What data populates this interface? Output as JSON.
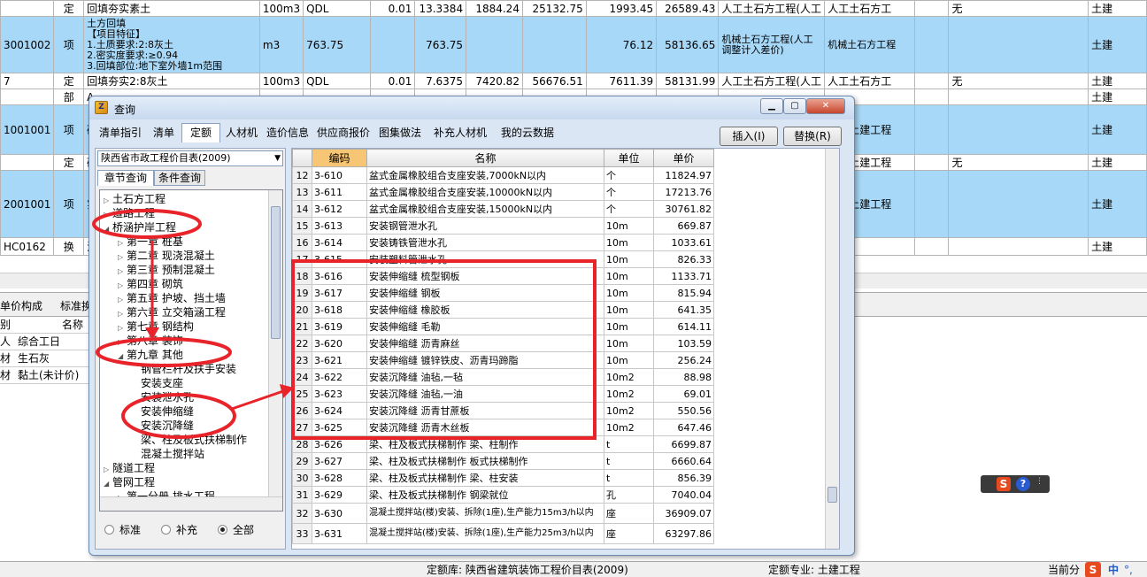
{
  "bg_rows": [
    {
      "code": "",
      "type": "定",
      "name": "回填夯实素土",
      "unit": "100m3",
      "qd": "QDL",
      "a": "0.01",
      "b": "13.3384",
      "c": "1884.24",
      "d": "25132.75",
      "e": "1993.45",
      "f": "26589.43",
      "g": "人工土石方工程(人工",
      "h": "人工土石方工",
      "i": "",
      "j": "无",
      "k": "土建"
    },
    {
      "code": "3001002",
      "type": "项",
      "name_lines": [
        "土方回填",
        "【项目特征】",
        "1.土质要求:2:8灰土",
        "2.密实度要求:≥0.94",
        "3.回填部位:地下室外墙1m范围"
      ],
      "unit": "m3",
      "qd": "763.75",
      "a": "",
      "b": "763.75",
      "c": "",
      "d": "",
      "e": "76.12",
      "f": "58136.65",
      "g": "机械土石方工程(人工调整计入差价)",
      "h": "机械土石方工程",
      "i": "",
      "j": "",
      "k": "土建"
    },
    {
      "code": "7",
      "type": "定",
      "name": "回填夯实2:8灰土",
      "unit": "100m3",
      "qd": "QDL",
      "a": "0.01",
      "b": "7.6375",
      "c": "7420.82",
      "d": "56676.51",
      "e": "7611.39",
      "f": "58131.99",
      "g": "人工土石方工程(人工",
      "h": "人工土石方工",
      "i": "",
      "j": "无",
      "k": "土建"
    },
    {
      "code": "",
      "type": "部",
      "name": "A.",
      "unit": "",
      "qd": "",
      "a": "",
      "b": "",
      "c": "",
      "d": "",
      "e": "",
      "f": "",
      "g": "",
      "h": "",
      "i": "",
      "j": "",
      "k": "土建"
    },
    {
      "code": "1001001",
      "type": "项",
      "name": "砖",
      "unit": "",
      "qd": "",
      "a": "",
      "b": "",
      "c": "",
      "d": "",
      "e": "",
      "f": "",
      "g": "",
      "h": "一般土建工程",
      "i": "",
      "j": "",
      "k": "土建"
    },
    {
      "code": "",
      "type": "定",
      "name": "砖",
      "unit": "",
      "qd": "",
      "a": "",
      "b": "",
      "c": "",
      "d": "",
      "e": "",
      "f": "",
      "g": "",
      "h": "一般土建工程",
      "i": "",
      "j": "无",
      "k": "土建"
    },
    {
      "code": "2001001",
      "type": "项",
      "name": "实",
      "unit": "",
      "qd": "",
      "a": "",
      "b": "",
      "c": "",
      "d": "",
      "e": "",
      "f": "",
      "g": "",
      "h": "一般土建工程",
      "i": "",
      "j": "",
      "k": "土建"
    },
    {
      "code": "HC0162",
      "type": "换",
      "name": "混",
      "unit": "",
      "qd": "",
      "a": "",
      "b": "",
      "c": "",
      "d": "",
      "e": "",
      "f": "",
      "g": "",
      "h": "",
      "i": "",
      "j": "",
      "k": "土建"
    }
  ],
  "lower": {
    "tabs": [
      "单价构成",
      "标准换"
    ],
    "col_type": "别",
    "col_name": "名称",
    "rows": [
      {
        "t": "人",
        "n": "综合工日"
      },
      {
        "t": "材",
        "n": "生石灰"
      },
      {
        "t": "材",
        "n": "黏土(未计价)"
      }
    ]
  },
  "status": {
    "lib": "定额库: 陕西省建筑装饰工程价目表(2009)",
    "major": "定额专业: 土建工程",
    "cur": "当前分"
  },
  "ime": {
    "zh": "中",
    "punct": "°,"
  },
  "dialog": {
    "title": "查询",
    "tabs": [
      "清单指引",
      "清单",
      "定额",
      "人材机",
      "造价信息",
      "供应商报价",
      "图集做法",
      "补充人材机",
      "我的云数据"
    ],
    "active_tab": "定额",
    "insert": "插入(I)",
    "replace": "替换(R)",
    "combo": "陕西省市政工程价目表(2009)",
    "subtabs": [
      "章节查询",
      "条件查询"
    ],
    "tree": [
      {
        "lv": 0,
        "tg": "▷",
        "t": "土石方工程"
      },
      {
        "lv": 0,
        "tg": "▷",
        "t": "道路工程"
      },
      {
        "lv": 0,
        "tg": "◢",
        "t": "桥涵护岸工程"
      },
      {
        "lv": 1,
        "tg": "▷",
        "t": "第一章 桩基"
      },
      {
        "lv": 1,
        "tg": "▷",
        "t": "第二章 现浇混凝土"
      },
      {
        "lv": 1,
        "tg": "▷",
        "t": "第三章 预制混凝土"
      },
      {
        "lv": 1,
        "tg": "▷",
        "t": "第四章 砌筑"
      },
      {
        "lv": 1,
        "tg": "▷",
        "t": "第五章 护坡、挡土墙"
      },
      {
        "lv": 1,
        "tg": "▷",
        "t": "第六章 立交箱涵工程"
      },
      {
        "lv": 1,
        "tg": "▷",
        "t": "第七章 钢结构"
      },
      {
        "lv": 1,
        "tg": "▷",
        "t": "第八章 装饰"
      },
      {
        "lv": 1,
        "tg": "◢",
        "t": "第九章 其他"
      },
      {
        "lv": 2,
        "tg": "",
        "t": "钢管栏杆及扶手安装"
      },
      {
        "lv": 2,
        "tg": "",
        "t": "安装支座"
      },
      {
        "lv": 2,
        "tg": "",
        "t": "安装泄水孔"
      },
      {
        "lv": 2,
        "tg": "",
        "t": "安装伸缩缝"
      },
      {
        "lv": 2,
        "tg": "",
        "t": "安装沉降缝"
      },
      {
        "lv": 2,
        "tg": "",
        "t": "梁、柱及板式扶梯制作"
      },
      {
        "lv": 2,
        "tg": "",
        "t": "混凝土搅拌站"
      },
      {
        "lv": 0,
        "tg": "▷",
        "t": "隧道工程"
      },
      {
        "lv": 0,
        "tg": "◢",
        "t": "管网工程"
      },
      {
        "lv": 1,
        "tg": "▷",
        "t": "第一分册 排水工程"
      }
    ],
    "radios": [
      "标准",
      "补充",
      "全部"
    ],
    "radio_selected": "全部",
    "headers": {
      "code": "编码",
      "name": "名称",
      "unit": "单位",
      "price": "单价"
    },
    "rows": [
      {
        "n": "12",
        "code": "3-610",
        "name": "盆式金属橡胶组合支座安装,7000kN以内",
        "unit": "个",
        "price": "11824.97"
      },
      {
        "n": "13",
        "code": "3-611",
        "name": "盆式金属橡胶组合支座安装,10000kN以内",
        "unit": "个",
        "price": "17213.76"
      },
      {
        "n": "14",
        "code": "3-612",
        "name": "盆式金属橡胶组合支座安装,15000kN以内",
        "unit": "个",
        "price": "30761.82"
      },
      {
        "n": "15",
        "code": "3-613",
        "name": "安装钢管泄水孔",
        "unit": "10m",
        "price": "669.87"
      },
      {
        "n": "16",
        "code": "3-614",
        "name": "安装铸铁管泄水孔",
        "unit": "10m",
        "price": "1033.61"
      },
      {
        "n": "17",
        "code": "3-615",
        "name": "安装塑料管泄水孔",
        "unit": "10m",
        "price": "826.33"
      },
      {
        "n": "18",
        "code": "3-616",
        "name": "安装伸缩缝 梳型钢板",
        "unit": "10m",
        "price": "1133.71"
      },
      {
        "n": "19",
        "code": "3-617",
        "name": "安装伸缩缝 钢板",
        "unit": "10m",
        "price": "815.94"
      },
      {
        "n": "20",
        "code": "3-618",
        "name": "安装伸缩缝 橡胶板",
        "unit": "10m",
        "price": "641.35"
      },
      {
        "n": "21",
        "code": "3-619",
        "name": "安装伸缩缝 毛勒",
        "unit": "10m",
        "price": "614.11"
      },
      {
        "n": "22",
        "code": "3-620",
        "name": "安装伸缩缝 沥青麻丝",
        "unit": "10m",
        "price": "103.59"
      },
      {
        "n": "23",
        "code": "3-621",
        "name": "安装伸缩缝 镀锌铁皮、沥青玛蹄脂",
        "unit": "10m",
        "price": "256.24"
      },
      {
        "n": "24",
        "code": "3-622",
        "name": "安装沉降缝 油毡,一毡",
        "unit": "10m2",
        "price": "88.98"
      },
      {
        "n": "25",
        "code": "3-623",
        "name": "安装沉降缝 油毡,一油",
        "unit": "10m2",
        "price": "69.01"
      },
      {
        "n": "26",
        "code": "3-624",
        "name": "安装沉降缝 沥青甘蔗板",
        "unit": "10m2",
        "price": "550.56"
      },
      {
        "n": "27",
        "code": "3-625",
        "name": "安装沉降缝 沥青木丝板",
        "unit": "10m2",
        "price": "647.46"
      },
      {
        "n": "28",
        "code": "3-626",
        "name": "梁、柱及板式扶梯制作 梁、柱制作",
        "unit": "t",
        "price": "6699.87"
      },
      {
        "n": "29",
        "code": "3-627",
        "name": "梁、柱及板式扶梯制作 板式扶梯制作",
        "unit": "t",
        "price": "6660.64"
      },
      {
        "n": "30",
        "code": "3-628",
        "name": "梁、柱及板式扶梯制作 梁、柱安装",
        "unit": "t",
        "price": "856.39"
      },
      {
        "n": "31",
        "code": "3-629",
        "name": "梁、柱及板式扶梯制作 钢梁就位",
        "unit": "孔",
        "price": "7040.04"
      },
      {
        "n": "32",
        "code": "3-630",
        "name": "混凝土搅拌站(楼)安装、拆除(1座),生产能力15m3/h以内",
        "unit": "座",
        "price": "36909.07"
      },
      {
        "n": "33",
        "code": "3-631",
        "name": "混凝土搅拌站(楼)安装、拆除(1座),生产能力25m3/h以内",
        "unit": "座",
        "price": "63297.86"
      }
    ]
  },
  "colors": {
    "selection": "#a8d8f7",
    "annotation": "#e8232a",
    "header_highlight": "#f6c674"
  }
}
